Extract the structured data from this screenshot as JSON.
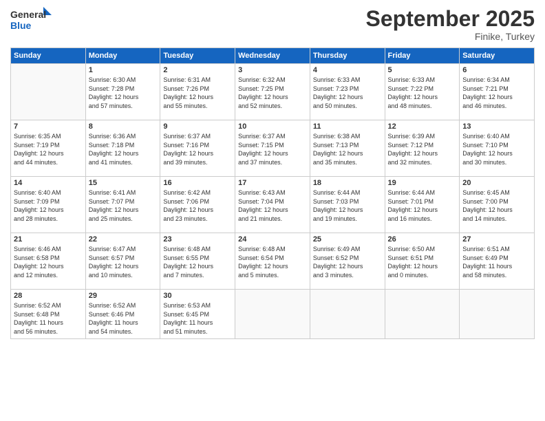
{
  "header": {
    "logo_general": "General",
    "logo_blue": "Blue",
    "month": "September 2025",
    "location": "Finike, Turkey"
  },
  "weekdays": [
    "Sunday",
    "Monday",
    "Tuesday",
    "Wednesday",
    "Thursday",
    "Friday",
    "Saturday"
  ],
  "weeks": [
    [
      {
        "day": "",
        "info": ""
      },
      {
        "day": "1",
        "info": "Sunrise: 6:30 AM\nSunset: 7:28 PM\nDaylight: 12 hours\nand 57 minutes."
      },
      {
        "day": "2",
        "info": "Sunrise: 6:31 AM\nSunset: 7:26 PM\nDaylight: 12 hours\nand 55 minutes."
      },
      {
        "day": "3",
        "info": "Sunrise: 6:32 AM\nSunset: 7:25 PM\nDaylight: 12 hours\nand 52 minutes."
      },
      {
        "day": "4",
        "info": "Sunrise: 6:33 AM\nSunset: 7:23 PM\nDaylight: 12 hours\nand 50 minutes."
      },
      {
        "day": "5",
        "info": "Sunrise: 6:33 AM\nSunset: 7:22 PM\nDaylight: 12 hours\nand 48 minutes."
      },
      {
        "day": "6",
        "info": "Sunrise: 6:34 AM\nSunset: 7:21 PM\nDaylight: 12 hours\nand 46 minutes."
      }
    ],
    [
      {
        "day": "7",
        "info": "Sunrise: 6:35 AM\nSunset: 7:19 PM\nDaylight: 12 hours\nand 44 minutes."
      },
      {
        "day": "8",
        "info": "Sunrise: 6:36 AM\nSunset: 7:18 PM\nDaylight: 12 hours\nand 41 minutes."
      },
      {
        "day": "9",
        "info": "Sunrise: 6:37 AM\nSunset: 7:16 PM\nDaylight: 12 hours\nand 39 minutes."
      },
      {
        "day": "10",
        "info": "Sunrise: 6:37 AM\nSunset: 7:15 PM\nDaylight: 12 hours\nand 37 minutes."
      },
      {
        "day": "11",
        "info": "Sunrise: 6:38 AM\nSunset: 7:13 PM\nDaylight: 12 hours\nand 35 minutes."
      },
      {
        "day": "12",
        "info": "Sunrise: 6:39 AM\nSunset: 7:12 PM\nDaylight: 12 hours\nand 32 minutes."
      },
      {
        "day": "13",
        "info": "Sunrise: 6:40 AM\nSunset: 7:10 PM\nDaylight: 12 hours\nand 30 minutes."
      }
    ],
    [
      {
        "day": "14",
        "info": "Sunrise: 6:40 AM\nSunset: 7:09 PM\nDaylight: 12 hours\nand 28 minutes."
      },
      {
        "day": "15",
        "info": "Sunrise: 6:41 AM\nSunset: 7:07 PM\nDaylight: 12 hours\nand 25 minutes."
      },
      {
        "day": "16",
        "info": "Sunrise: 6:42 AM\nSunset: 7:06 PM\nDaylight: 12 hours\nand 23 minutes."
      },
      {
        "day": "17",
        "info": "Sunrise: 6:43 AM\nSunset: 7:04 PM\nDaylight: 12 hours\nand 21 minutes."
      },
      {
        "day": "18",
        "info": "Sunrise: 6:44 AM\nSunset: 7:03 PM\nDaylight: 12 hours\nand 19 minutes."
      },
      {
        "day": "19",
        "info": "Sunrise: 6:44 AM\nSunset: 7:01 PM\nDaylight: 12 hours\nand 16 minutes."
      },
      {
        "day": "20",
        "info": "Sunrise: 6:45 AM\nSunset: 7:00 PM\nDaylight: 12 hours\nand 14 minutes."
      }
    ],
    [
      {
        "day": "21",
        "info": "Sunrise: 6:46 AM\nSunset: 6:58 PM\nDaylight: 12 hours\nand 12 minutes."
      },
      {
        "day": "22",
        "info": "Sunrise: 6:47 AM\nSunset: 6:57 PM\nDaylight: 12 hours\nand 10 minutes."
      },
      {
        "day": "23",
        "info": "Sunrise: 6:48 AM\nSunset: 6:55 PM\nDaylight: 12 hours\nand 7 minutes."
      },
      {
        "day": "24",
        "info": "Sunrise: 6:48 AM\nSunset: 6:54 PM\nDaylight: 12 hours\nand 5 minutes."
      },
      {
        "day": "25",
        "info": "Sunrise: 6:49 AM\nSunset: 6:52 PM\nDaylight: 12 hours\nand 3 minutes."
      },
      {
        "day": "26",
        "info": "Sunrise: 6:50 AM\nSunset: 6:51 PM\nDaylight: 12 hours\nand 0 minutes."
      },
      {
        "day": "27",
        "info": "Sunrise: 6:51 AM\nSunset: 6:49 PM\nDaylight: 11 hours\nand 58 minutes."
      }
    ],
    [
      {
        "day": "28",
        "info": "Sunrise: 6:52 AM\nSunset: 6:48 PM\nDaylight: 11 hours\nand 56 minutes."
      },
      {
        "day": "29",
        "info": "Sunrise: 6:52 AM\nSunset: 6:46 PM\nDaylight: 11 hours\nand 54 minutes."
      },
      {
        "day": "30",
        "info": "Sunrise: 6:53 AM\nSunset: 6:45 PM\nDaylight: 11 hours\nand 51 minutes."
      },
      {
        "day": "",
        "info": ""
      },
      {
        "day": "",
        "info": ""
      },
      {
        "day": "",
        "info": ""
      },
      {
        "day": "",
        "info": ""
      }
    ]
  ]
}
